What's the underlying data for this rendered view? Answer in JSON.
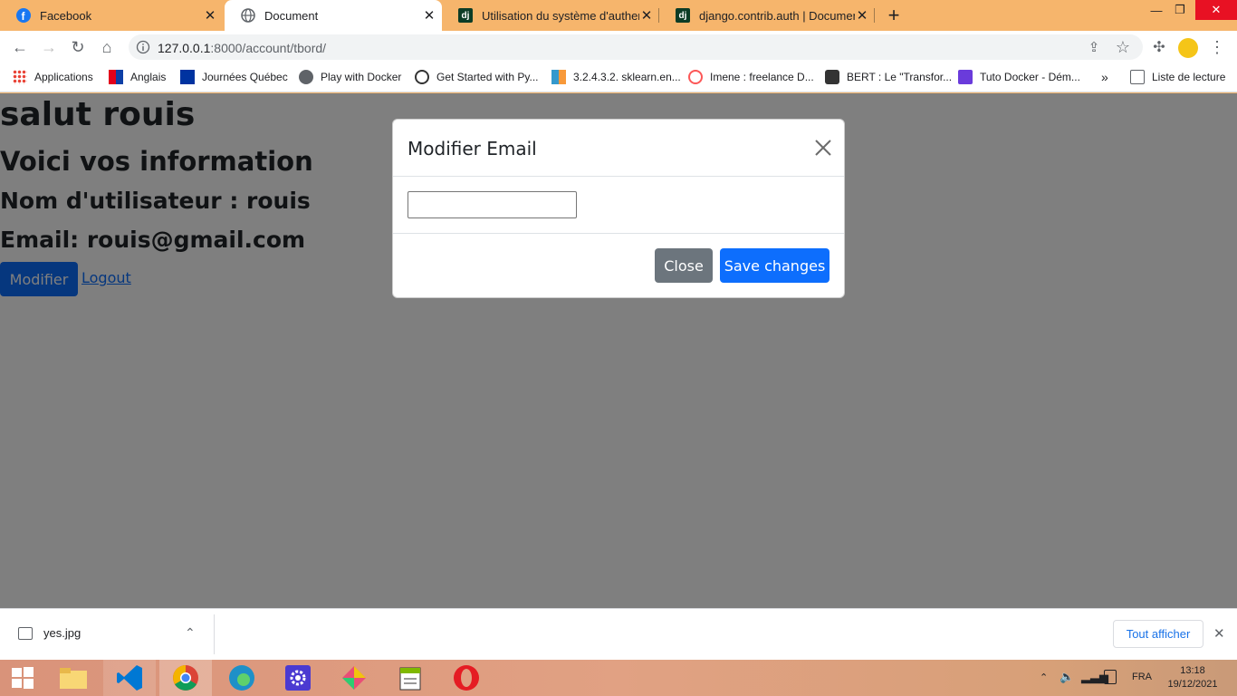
{
  "tabs": [
    {
      "title": "Facebook",
      "icon": "facebook-icon"
    },
    {
      "title": "Document",
      "icon": "globe-icon",
      "active": true
    },
    {
      "title": "Utilisation du système d'authentific",
      "icon": "django-icon"
    },
    {
      "title": "django.contrib.auth | Documentat",
      "icon": "django-icon"
    }
  ],
  "favicon_text": {
    "django": "dj"
  },
  "toolbar": {
    "url_host": "127.0.0.1",
    "url_rest": ":8000/account/tbord/"
  },
  "bookmarks": [
    {
      "label": "Applications"
    },
    {
      "label": "Anglais"
    },
    {
      "label": "Journées Québec"
    },
    {
      "label": "Play with Docker"
    },
    {
      "label": "Get Started with Py..."
    },
    {
      "label": "3.2.4.3.2. sklearn.en..."
    },
    {
      "label": "Imene : freelance D..."
    },
    {
      "label": "BERT : Le \"Transfor..."
    },
    {
      "label": "Tuto Docker - Dém..."
    }
  ],
  "reading_list": "Liste de lecture",
  "page": {
    "greeting": "salut rouis",
    "subtitle": "Voici vos information",
    "username_line": "Nom d'utilisateur : rouis",
    "email_line": "Email: rouis@gmail.com",
    "modify_button": "Modifier",
    "logout_link": "Logout"
  },
  "modal": {
    "title": "Modifier Email",
    "input_value": "",
    "close_button": "Close",
    "save_button": "Save changes"
  },
  "download": {
    "filename": "yes.jpg",
    "show_all": "Tout afficher"
  },
  "taskbar": {
    "lang": "FRA",
    "time": "13:18",
    "date": "19/12/2021"
  },
  "colors": {
    "primary": "#0d6efd",
    "secondary": "#6c757d",
    "chrome_frame": "#f6b56c"
  }
}
